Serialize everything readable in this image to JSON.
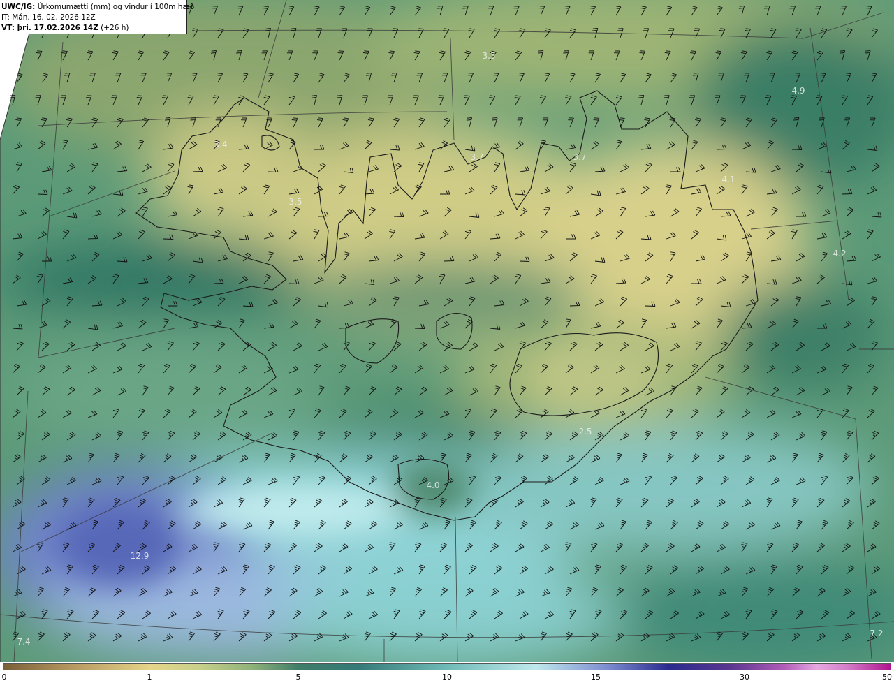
{
  "header": {
    "line1_prefix": "UWC/IG:",
    "line1_text": "Úrkomumætti (mm) og vindur í 100m hæð",
    "line2_text": "IT: Mán. 16. 02. 2026 12Z",
    "line3_prefix": "VT: þri. 17.02.2026 14Z",
    "line3_suffix": "(+26 h)"
  },
  "colorbar": {
    "tick_labels": [
      "0",
      "1",
      "5",
      "10",
      "15",
      "30",
      "50"
    ]
  },
  "map_labels": [
    "3.3",
    "4.9",
    "3.4",
    "3.7",
    "3.7",
    "4.1",
    "3.5",
    "4.2",
    "2.5",
    "4.0",
    "12.9",
    "7.4",
    "7.2"
  ],
  "colors": {
    "land_yellow": "#e3dc95",
    "green": "#3e7e66",
    "cyan": "#8fd3d6",
    "blue": "#6f83c9",
    "coast": "#1a1a1a"
  }
}
